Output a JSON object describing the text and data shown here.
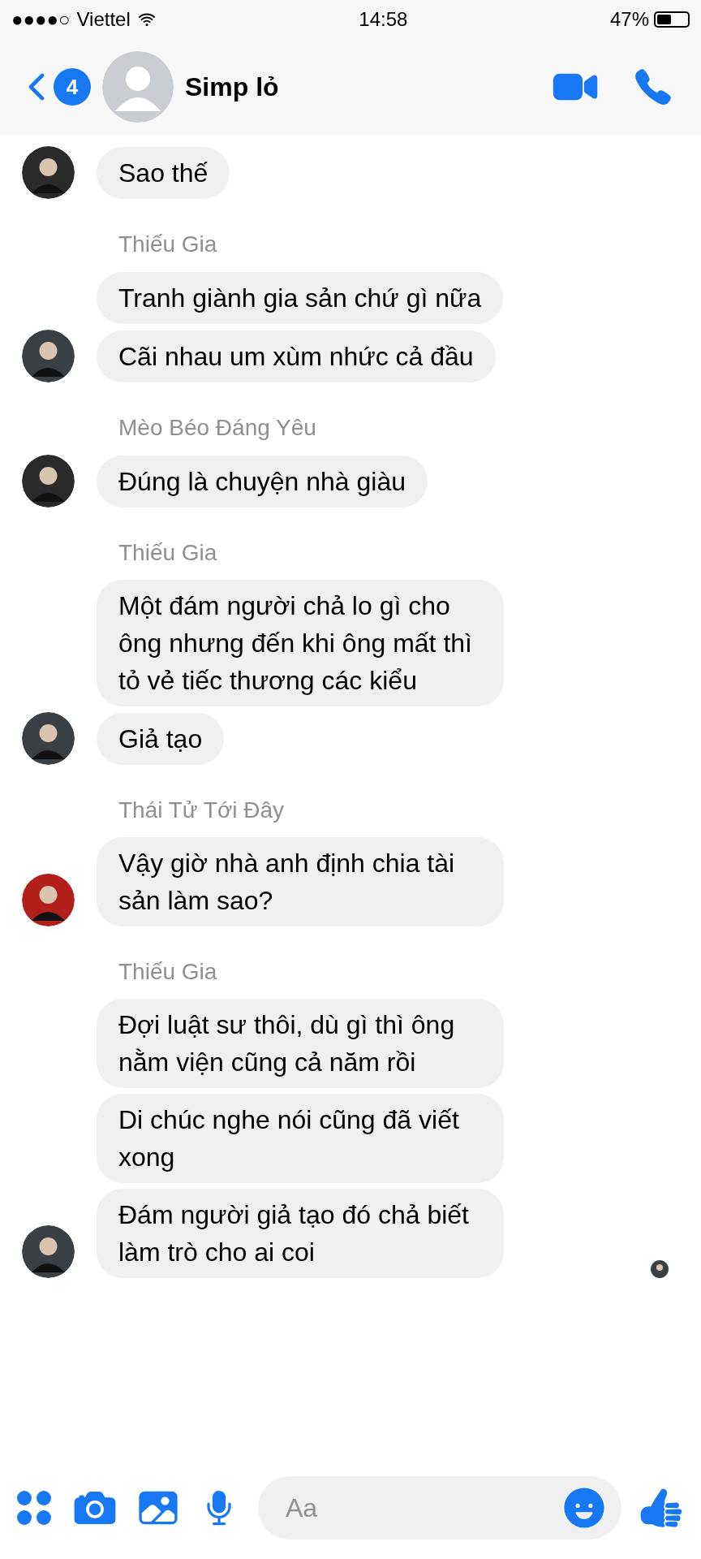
{
  "status_bar": {
    "signal": "●●●●○",
    "carrier": "Viettel",
    "time": "14:58",
    "battery": "47%"
  },
  "header": {
    "back_badge": "4",
    "name": "Simp lỏ"
  },
  "groups": [
    {
      "color": "#2a2a2a",
      "messages": [
        "Sao thế"
      ]
    },
    {
      "sender": "Thiếu Gia",
      "color": "#3a3f44",
      "messages": [
        "Tranh giành gia sản chứ gì nữa",
        "Cãi nhau um xùm nhức cả đầu"
      ]
    },
    {
      "sender": "Mèo Béo Đáng Yêu",
      "color": "#2a2a2a",
      "messages": [
        "Đúng là chuyện nhà giàu"
      ]
    },
    {
      "sender": "Thiếu Gia",
      "color": "#3a3f44",
      "messages": [
        "Một đám người chả lo gì cho ông nhưng đến khi ông mất thì tỏ vẻ tiếc thương các kiểu",
        "Giả tạo"
      ]
    },
    {
      "sender": "Thái Tử Tới Đây",
      "color": "#b3201c",
      "messages": [
        "Vậy giờ nhà anh định chia tài sản làm sao?"
      ]
    },
    {
      "sender": "Thiếu Gia",
      "color": "#3a3f44",
      "messages": [
        "Đợi luật sư thôi, dù gì thì ông nằm viện cũng cả năm rồi",
        "Di chúc nghe nói cũng đã viết xong",
        "Đám người giả tạo đó chả biết làm trò cho ai coi"
      ]
    }
  ],
  "composer": {
    "placeholder": "Aa"
  }
}
